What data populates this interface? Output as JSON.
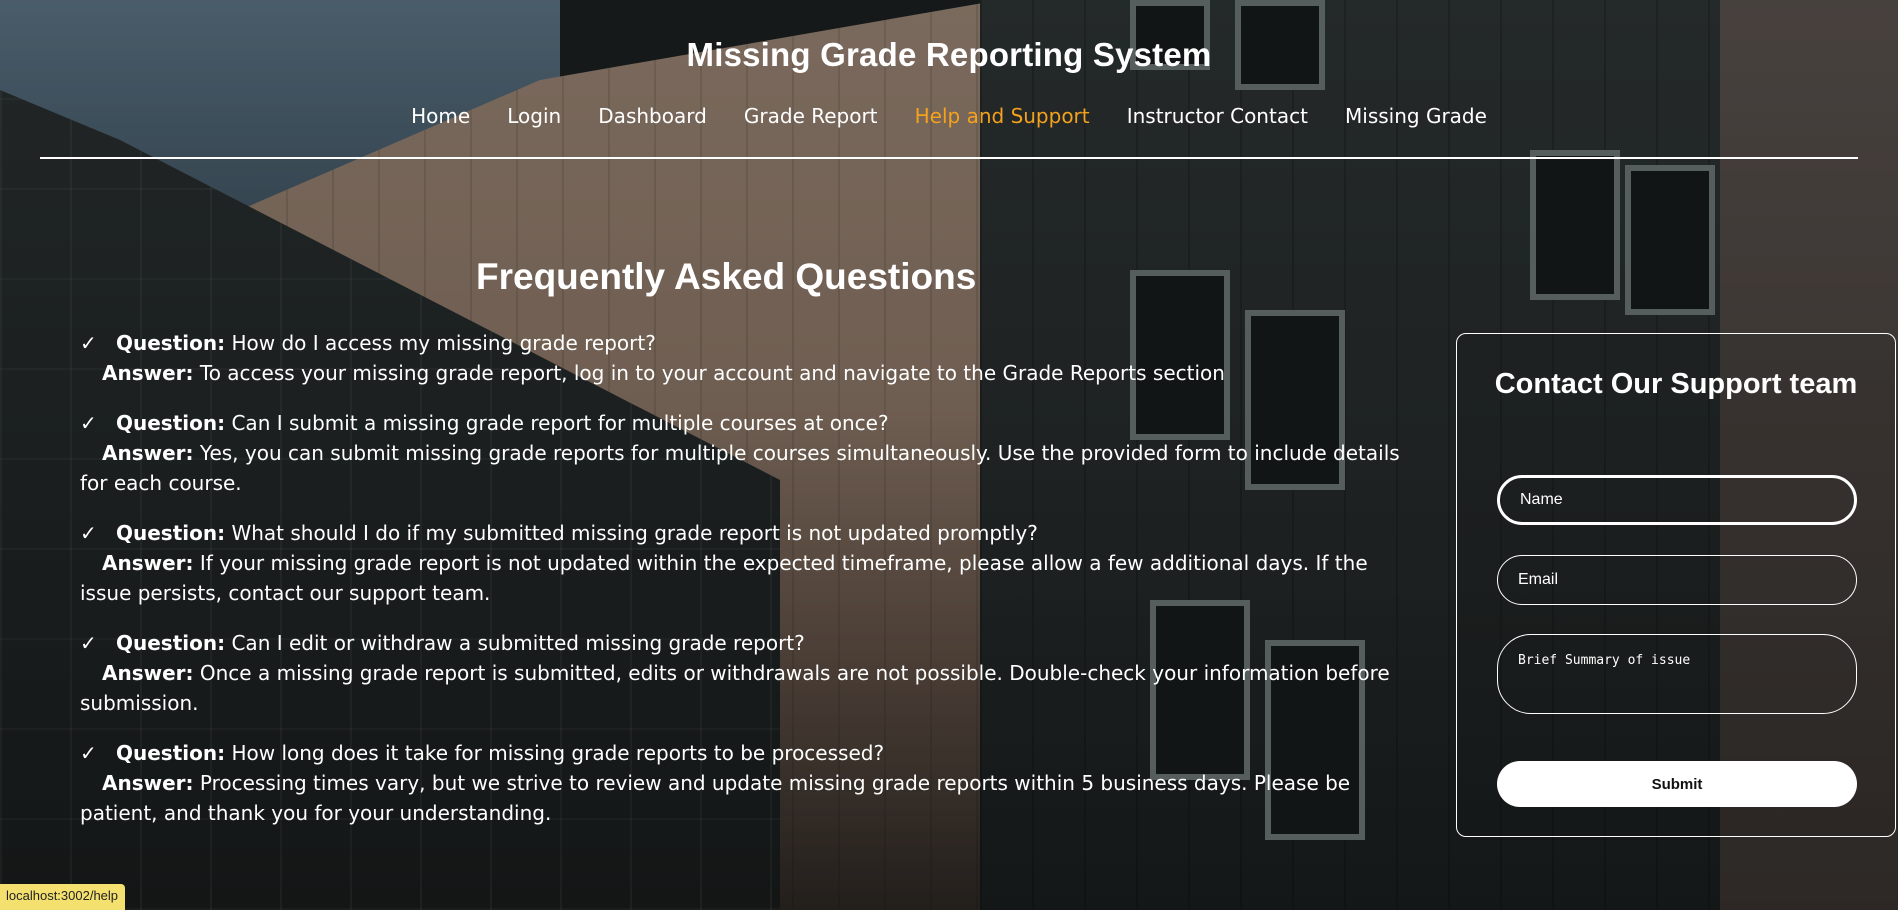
{
  "site": {
    "title": "Missing Grade Reporting System"
  },
  "nav": {
    "items": [
      {
        "label": "Home"
      },
      {
        "label": "Login"
      },
      {
        "label": "Dashboard"
      },
      {
        "label": "Grade Report"
      },
      {
        "label": "Help and Support"
      },
      {
        "label": "Instructor Contact"
      },
      {
        "label": "Missing Grade"
      }
    ],
    "active": "Help and Support",
    "active_color": "#f4a21d"
  },
  "faq": {
    "title": "Frequently Asked Questions",
    "check_glyph": "✓",
    "question_label": "Question:",
    "answer_label": "Answer:",
    "items": [
      {
        "question": "How do I access my missing grade report?",
        "answer": "To access your missing grade report, log in to your account and navigate to the Grade Reports section"
      },
      {
        "question": "Can I submit a missing grade report for multiple courses at once?",
        "answer": "Yes, you can submit missing grade reports for multiple courses simultaneously. Use the provided form to include details for each course."
      },
      {
        "question": "What should I do if my submitted missing grade report is not updated promptly?",
        "answer": "If your missing grade report is not updated within the expected timeframe, please allow a few additional days. If the issue persists, contact our support team."
      },
      {
        "question": "Can I edit or withdraw a submitted missing grade report?",
        "answer": "Once a missing grade report is submitted, edits or withdrawals are not possible. Double-check your information before submission."
      },
      {
        "question": "How long does it take for missing grade reports to be processed?",
        "answer": "Processing times vary, but we strive to review and update missing grade reports within 5 business days. Please be patient, and thank you for your understanding."
      }
    ]
  },
  "contact": {
    "title": "Contact Our Support team",
    "name_placeholder": "Name",
    "email_placeholder": "Email",
    "summary_placeholder": "Brief Summary of issue",
    "submit_label": "Submit"
  },
  "status_bar": {
    "url": "localhost:3002/help",
    "color": "#f4e06f"
  }
}
